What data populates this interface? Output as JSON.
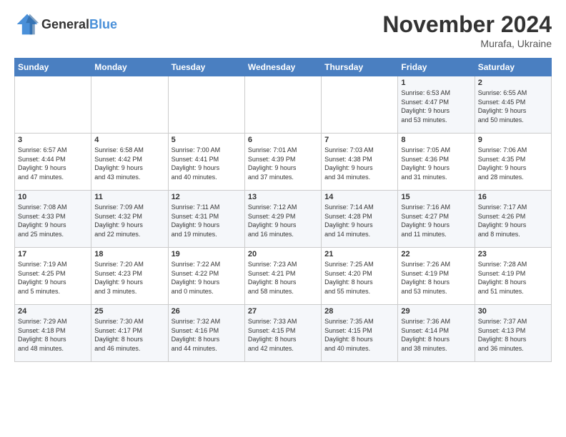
{
  "header": {
    "logo_line1": "General",
    "logo_line2": "Blue",
    "month": "November 2024",
    "location": "Murafa, Ukraine"
  },
  "days_of_week": [
    "Sunday",
    "Monday",
    "Tuesday",
    "Wednesday",
    "Thursday",
    "Friday",
    "Saturday"
  ],
  "weeks": [
    [
      {
        "day": "",
        "info": ""
      },
      {
        "day": "",
        "info": ""
      },
      {
        "day": "",
        "info": ""
      },
      {
        "day": "",
        "info": ""
      },
      {
        "day": "",
        "info": ""
      },
      {
        "day": "1",
        "info": "Sunrise: 6:53 AM\nSunset: 4:47 PM\nDaylight: 9 hours\nand 53 minutes."
      },
      {
        "day": "2",
        "info": "Sunrise: 6:55 AM\nSunset: 4:45 PM\nDaylight: 9 hours\nand 50 minutes."
      }
    ],
    [
      {
        "day": "3",
        "info": "Sunrise: 6:57 AM\nSunset: 4:44 PM\nDaylight: 9 hours\nand 47 minutes."
      },
      {
        "day": "4",
        "info": "Sunrise: 6:58 AM\nSunset: 4:42 PM\nDaylight: 9 hours\nand 43 minutes."
      },
      {
        "day": "5",
        "info": "Sunrise: 7:00 AM\nSunset: 4:41 PM\nDaylight: 9 hours\nand 40 minutes."
      },
      {
        "day": "6",
        "info": "Sunrise: 7:01 AM\nSunset: 4:39 PM\nDaylight: 9 hours\nand 37 minutes."
      },
      {
        "day": "7",
        "info": "Sunrise: 7:03 AM\nSunset: 4:38 PM\nDaylight: 9 hours\nand 34 minutes."
      },
      {
        "day": "8",
        "info": "Sunrise: 7:05 AM\nSunset: 4:36 PM\nDaylight: 9 hours\nand 31 minutes."
      },
      {
        "day": "9",
        "info": "Sunrise: 7:06 AM\nSunset: 4:35 PM\nDaylight: 9 hours\nand 28 minutes."
      }
    ],
    [
      {
        "day": "10",
        "info": "Sunrise: 7:08 AM\nSunset: 4:33 PM\nDaylight: 9 hours\nand 25 minutes."
      },
      {
        "day": "11",
        "info": "Sunrise: 7:09 AM\nSunset: 4:32 PM\nDaylight: 9 hours\nand 22 minutes."
      },
      {
        "day": "12",
        "info": "Sunrise: 7:11 AM\nSunset: 4:31 PM\nDaylight: 9 hours\nand 19 minutes."
      },
      {
        "day": "13",
        "info": "Sunrise: 7:12 AM\nSunset: 4:29 PM\nDaylight: 9 hours\nand 16 minutes."
      },
      {
        "day": "14",
        "info": "Sunrise: 7:14 AM\nSunset: 4:28 PM\nDaylight: 9 hours\nand 14 minutes."
      },
      {
        "day": "15",
        "info": "Sunrise: 7:16 AM\nSunset: 4:27 PM\nDaylight: 9 hours\nand 11 minutes."
      },
      {
        "day": "16",
        "info": "Sunrise: 7:17 AM\nSunset: 4:26 PM\nDaylight: 9 hours\nand 8 minutes."
      }
    ],
    [
      {
        "day": "17",
        "info": "Sunrise: 7:19 AM\nSunset: 4:25 PM\nDaylight: 9 hours\nand 5 minutes."
      },
      {
        "day": "18",
        "info": "Sunrise: 7:20 AM\nSunset: 4:23 PM\nDaylight: 9 hours\nand 3 minutes."
      },
      {
        "day": "19",
        "info": "Sunrise: 7:22 AM\nSunset: 4:22 PM\nDaylight: 9 hours\nand 0 minutes."
      },
      {
        "day": "20",
        "info": "Sunrise: 7:23 AM\nSunset: 4:21 PM\nDaylight: 8 hours\nand 58 minutes."
      },
      {
        "day": "21",
        "info": "Sunrise: 7:25 AM\nSunset: 4:20 PM\nDaylight: 8 hours\nand 55 minutes."
      },
      {
        "day": "22",
        "info": "Sunrise: 7:26 AM\nSunset: 4:19 PM\nDaylight: 8 hours\nand 53 minutes."
      },
      {
        "day": "23",
        "info": "Sunrise: 7:28 AM\nSunset: 4:19 PM\nDaylight: 8 hours\nand 51 minutes."
      }
    ],
    [
      {
        "day": "24",
        "info": "Sunrise: 7:29 AM\nSunset: 4:18 PM\nDaylight: 8 hours\nand 48 minutes."
      },
      {
        "day": "25",
        "info": "Sunrise: 7:30 AM\nSunset: 4:17 PM\nDaylight: 8 hours\nand 46 minutes."
      },
      {
        "day": "26",
        "info": "Sunrise: 7:32 AM\nSunset: 4:16 PM\nDaylight: 8 hours\nand 44 minutes."
      },
      {
        "day": "27",
        "info": "Sunrise: 7:33 AM\nSunset: 4:15 PM\nDaylight: 8 hours\nand 42 minutes."
      },
      {
        "day": "28",
        "info": "Sunrise: 7:35 AM\nSunset: 4:15 PM\nDaylight: 8 hours\nand 40 minutes."
      },
      {
        "day": "29",
        "info": "Sunrise: 7:36 AM\nSunset: 4:14 PM\nDaylight: 8 hours\nand 38 minutes."
      },
      {
        "day": "30",
        "info": "Sunrise: 7:37 AM\nSunset: 4:13 PM\nDaylight: 8 hours\nand 36 minutes."
      }
    ]
  ]
}
